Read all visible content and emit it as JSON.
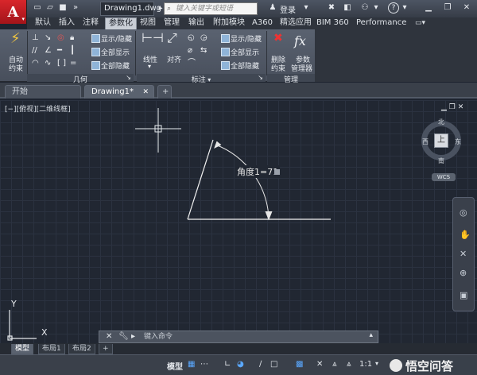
{
  "titlebar": {
    "logo_text": "A",
    "doc_title": "Drawing1.dwg",
    "search_placeholder": "键入关键字或短语",
    "login_label": "登录",
    "help_label": "?"
  },
  "ribbon_tabs": [
    "默认",
    "插入",
    "注释",
    "参数化",
    "视图",
    "管理",
    "输出",
    "附加模块",
    "A360",
    "精选应用",
    "BIM 360",
    "Performance"
  ],
  "active_ribbon_tab": "参数化",
  "ribbon": {
    "geometric": {
      "auto_constrain_line1": "自动",
      "auto_constrain_line2": "约束",
      "show_hide": "显示/隐藏",
      "show_all": "全部显示",
      "hide_all": "全部隐藏",
      "panel_title": "几何"
    },
    "dimensional": {
      "linear": "线性",
      "aligned": "对齐",
      "show_hide": "显示/隐藏",
      "show_all": "全部显示",
      "hide_all": "全部隐藏",
      "panel_title": "标注"
    },
    "manage": {
      "delete_line1": "删除",
      "delete_line2": "约束",
      "params_line1": "参数",
      "params_line2": "管理器",
      "panel_title": "管理"
    }
  },
  "file_tabs": {
    "start": "开始",
    "drawing": "Drawing1*",
    "new": "+"
  },
  "viewport": {
    "label": "[−][俯视][二维线框]",
    "compass": {
      "north": "北",
      "south": "南",
      "west": "西",
      "east": "东",
      "center": "上"
    },
    "wcs": "WCS",
    "dimension_text": "角度1=71",
    "ucs_x": "X",
    "ucs_y": "Y"
  },
  "command_line": {
    "placeholder": "键入命令"
  },
  "layout_tabs": [
    "模型",
    "布局1",
    "布局2"
  ],
  "active_layout_tab": "模型",
  "statusbar": {
    "model": "模型",
    "scale": "1:1"
  },
  "watermark": "悟空问答",
  "colors": {
    "accent_red": "#c8232a",
    "canvas": "#212732",
    "ribbon": "#505866"
  }
}
